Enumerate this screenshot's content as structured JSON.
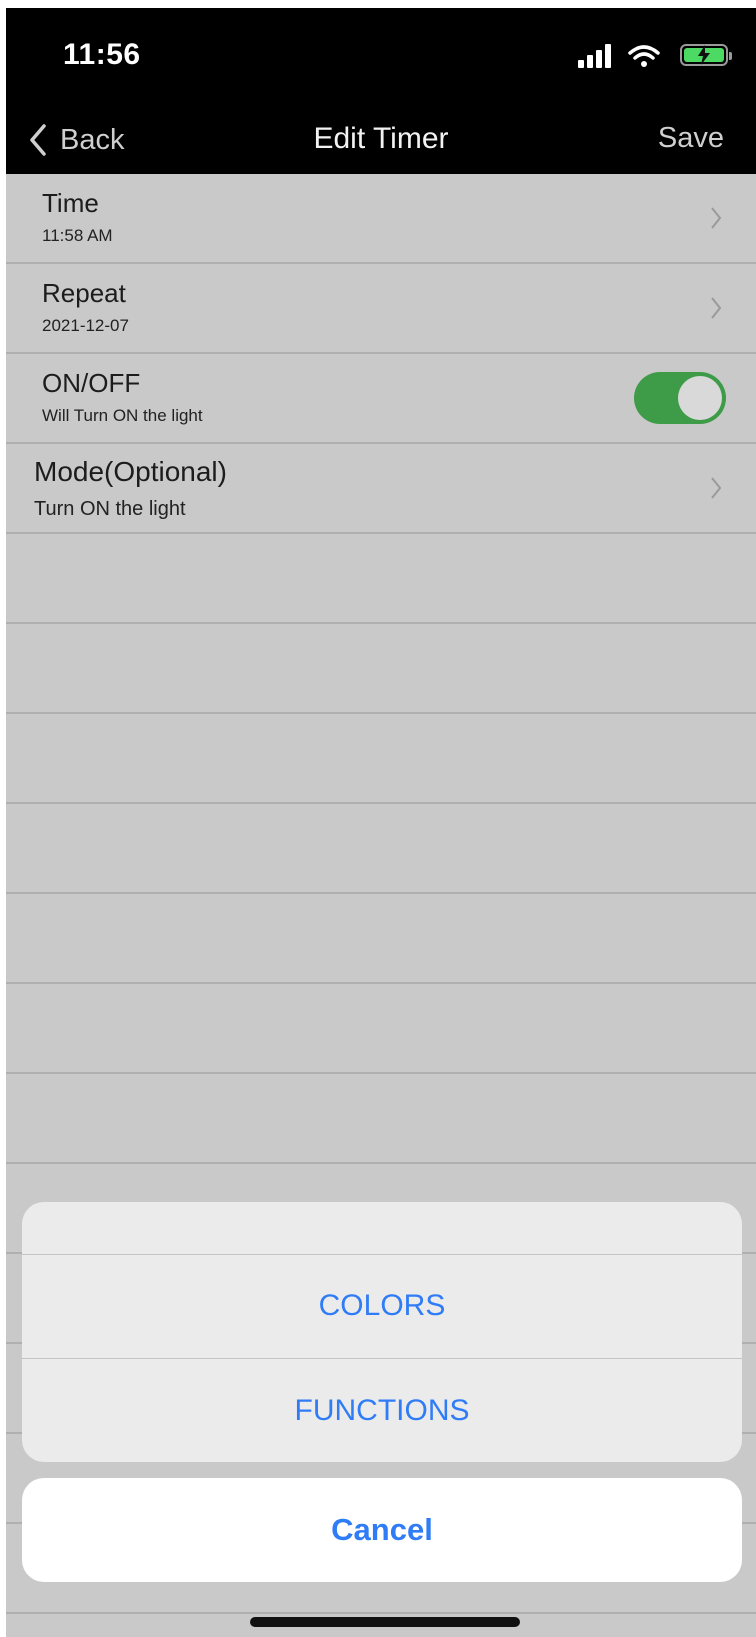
{
  "status_bar": {
    "time": "11:56",
    "icons": [
      "signal-icon",
      "wifi-icon",
      "battery-charging-icon"
    ]
  },
  "nav": {
    "back_label": "Back",
    "title": "Edit Timer",
    "save_label": "Save"
  },
  "rows": {
    "time": {
      "title": "Time",
      "value": "11:58 AM"
    },
    "repeat": {
      "title": "Repeat",
      "value": "2021-12-07"
    },
    "onoff": {
      "title": "ON/OFF",
      "value": "Will Turn ON the light",
      "toggle_on": true
    },
    "mode": {
      "title": "Mode(Optional)",
      "value": "Turn ON the light"
    }
  },
  "action_sheet": {
    "options": [
      "COLORS",
      "FUNCTIONS"
    ],
    "cancel_label": "Cancel"
  },
  "colors": {
    "accent_blue": "#2f7cf6",
    "toggle_green": "#3e9b47"
  }
}
